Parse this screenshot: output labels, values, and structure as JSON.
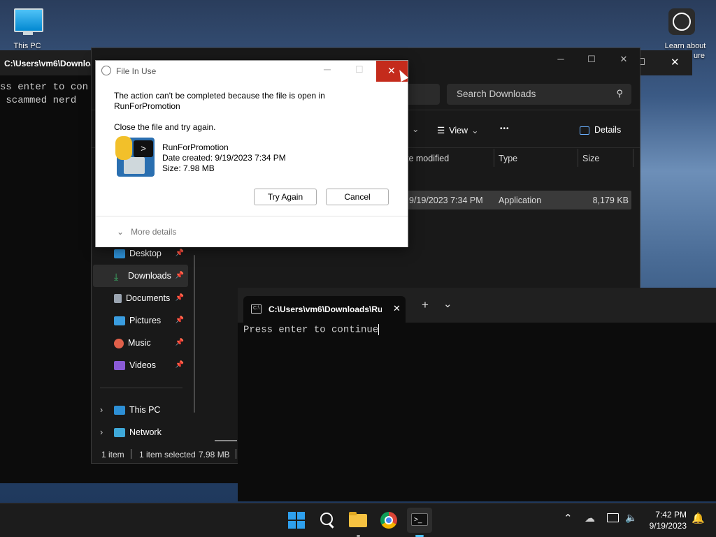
{
  "desktop": {
    "this_pc_label": "This PC",
    "learn_label": "Learn about",
    "learn_label2": "ure"
  },
  "back_console": {
    "title": "C:\\Users\\vm6\\Downloa",
    "line1": "ss enter to con",
    "line2": " scammed nerd",
    "close_glyph": "✕",
    "max_glyph": "□"
  },
  "explorer": {
    "search_placeholder": "Search Downloads",
    "view_label": "View",
    "details_label": "Details",
    "more_glyph": "•••",
    "columns": [
      "te modified",
      "Type",
      "Size"
    ],
    "row": {
      "date": "9/19/2023 7:34 PM",
      "type": "Application",
      "size": "8,179 KB"
    },
    "nav": [
      {
        "label": "Desktop",
        "icon": "desktop-icon",
        "color": "#2d8fd5"
      },
      {
        "label": "Downloads",
        "icon": "download-icon",
        "color": "#3bb86a"
      },
      {
        "label": "Documents",
        "icon": "documents-icon",
        "color": "#9aa4b0"
      },
      {
        "label": "Pictures",
        "icon": "pictures-icon",
        "color": "#3a9de0"
      },
      {
        "label": "Music",
        "icon": "music-icon",
        "color": "#e0604a"
      },
      {
        "label": "Videos",
        "icon": "videos-icon",
        "color": "#8a5ad6"
      }
    ],
    "this_pc": "This PC",
    "network": "Network",
    "status": {
      "items": "1 item",
      "selected": "1 item selected",
      "size": "7.98 MB"
    }
  },
  "dialog": {
    "title": "File In Use",
    "message_line1": "The action can't be completed because the file is open in",
    "message_line2": "RunForPromotion",
    "instruction": "Close the file and try again.",
    "file_name": "RunForPromotion",
    "date_created": "Date created: 9/19/2023 7:34 PM",
    "size": "Size: 7.98 MB",
    "try_again": "Try Again",
    "cancel": "Cancel",
    "more_details": "More details"
  },
  "terminal": {
    "tab_title": "C:\\Users\\vm6\\Downloads\\Rur",
    "output": "Press enter to continue",
    "new_tab_glyph": "+",
    "dropdown_glyph": "⌄"
  },
  "taskbar": {
    "time": "7:42 PM",
    "date": "9/19/2023"
  }
}
